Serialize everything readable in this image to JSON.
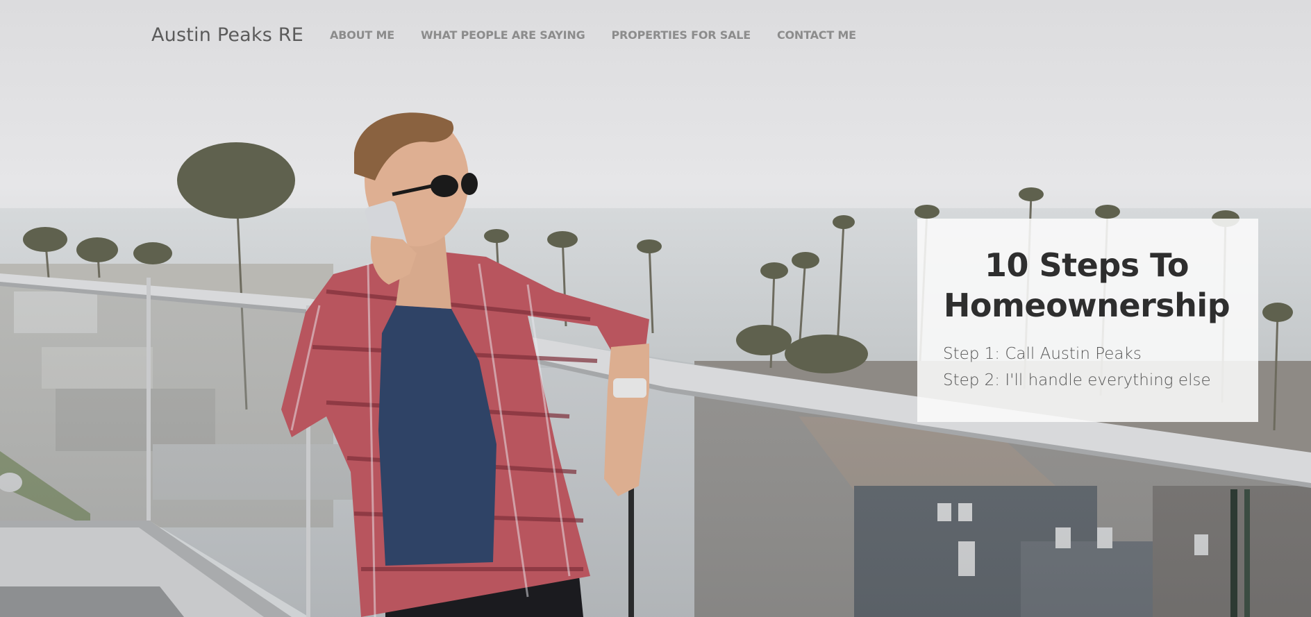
{
  "nav": {
    "brand": "Austin Peaks RE",
    "links": [
      {
        "label": "ABOUT ME"
      },
      {
        "label": "WHAT PEOPLE ARE SAYING"
      },
      {
        "label": "PROPERTIES FOR SALE"
      },
      {
        "label": "CONTACT ME"
      }
    ]
  },
  "promo": {
    "title": "10 Steps To Homeownership",
    "steps": [
      "Step 1: Call Austin Peaks",
      "Step 2: I'll handle everything else"
    ]
  },
  "hero_image": {
    "description_icon": "man-on-phone-balcony-photo"
  },
  "colors": {
    "brand_text": "#5b5b5b",
    "nav_text": "#8c8c8c",
    "card_bg": "#fafafa",
    "title_text": "#2e2e2e"
  }
}
